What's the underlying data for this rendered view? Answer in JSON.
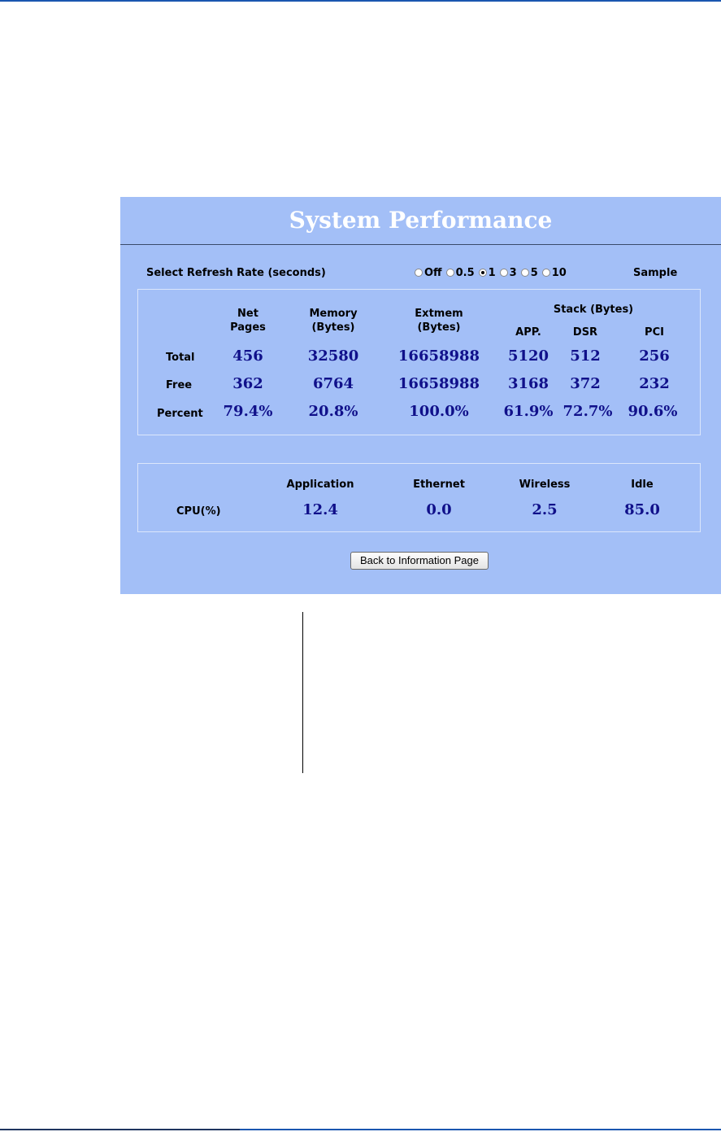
{
  "title": "System Performance",
  "refresh": {
    "label": "Select Refresh Rate (seconds)",
    "options": [
      "Off",
      "0.5",
      "1",
      "3",
      "5",
      "10"
    ],
    "selected": "1",
    "sample_label": "Sample"
  },
  "memory": {
    "headers": {
      "net_pages": [
        "Net",
        "Pages"
      ],
      "memory": [
        "Memory",
        "(Bytes)"
      ],
      "extmem": [
        "Extmem",
        "(Bytes)"
      ],
      "stack_group": "Stack (Bytes)",
      "app": "APP.",
      "dsr": "DSR",
      "pci": "PCI"
    },
    "rows": [
      {
        "label": "Total",
        "net_pages": "456",
        "memory": "32580",
        "extmem": "16658988",
        "app": "5120",
        "dsr": "512",
        "pci": "256"
      },
      {
        "label": "Free",
        "net_pages": "362",
        "memory": "6764",
        "extmem": "16658988",
        "app": "3168",
        "dsr": "372",
        "pci": "232"
      },
      {
        "label": "Percent",
        "net_pages": "79.4%",
        "memory": "20.8%",
        "extmem": "100.0%",
        "app": "61.9%",
        "dsr": "72.7%",
        "pci": "90.6%"
      }
    ]
  },
  "cpu": {
    "row_label": "CPU(%)",
    "headers": {
      "application": "Application",
      "ethernet": "Ethernet",
      "wireless": "Wireless",
      "idle": "Idle"
    },
    "values": {
      "application": "12.4",
      "ethernet": "0.0",
      "wireless": "2.5",
      "idle": "85.0"
    }
  },
  "back_button": "Back to Information Page",
  "colors": {
    "panel_bg": "#a3bff7",
    "value_text": "#10108a",
    "title_text": "#ffffff",
    "doc_rule": "#1a56b0"
  }
}
